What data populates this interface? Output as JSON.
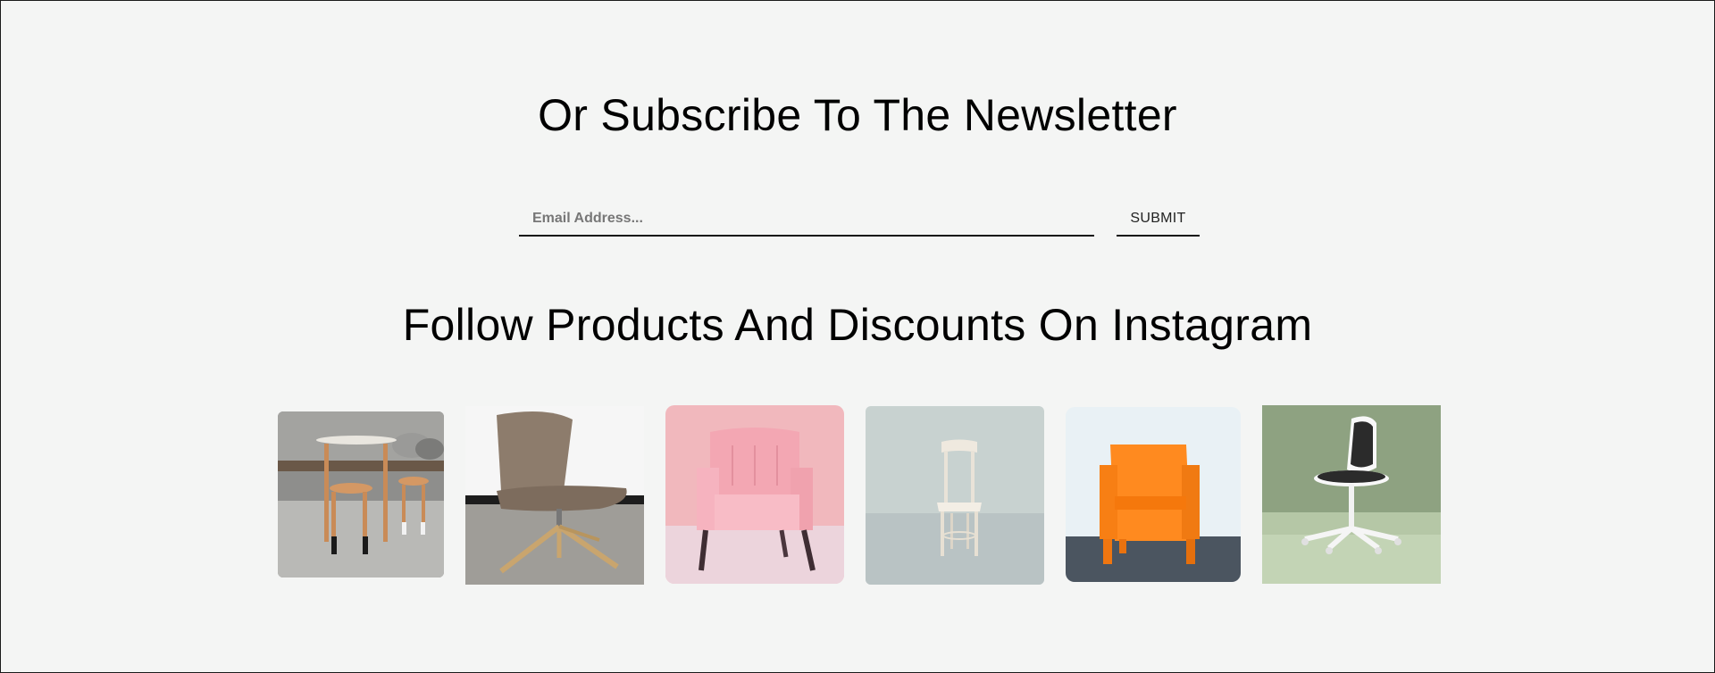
{
  "newsletter": {
    "title": "Or Subscribe To The Newsletter",
    "email_placeholder": "Email Address...",
    "submit_label": "SUBMIT"
  },
  "instagram": {
    "title": "Follow Products And Discounts On Instagram",
    "images": [
      {
        "subject": "wooden-table-and-stools"
      },
      {
        "subject": "beige-lounge-chair"
      },
      {
        "subject": "pink-armchair"
      },
      {
        "subject": "white-wooden-chair"
      },
      {
        "subject": "orange-plastic-chair"
      },
      {
        "subject": "white-swivel-desk-chair"
      }
    ]
  },
  "colors": {
    "background": "#f4f5f4",
    "text": "#000000",
    "underline": "#111111"
  }
}
